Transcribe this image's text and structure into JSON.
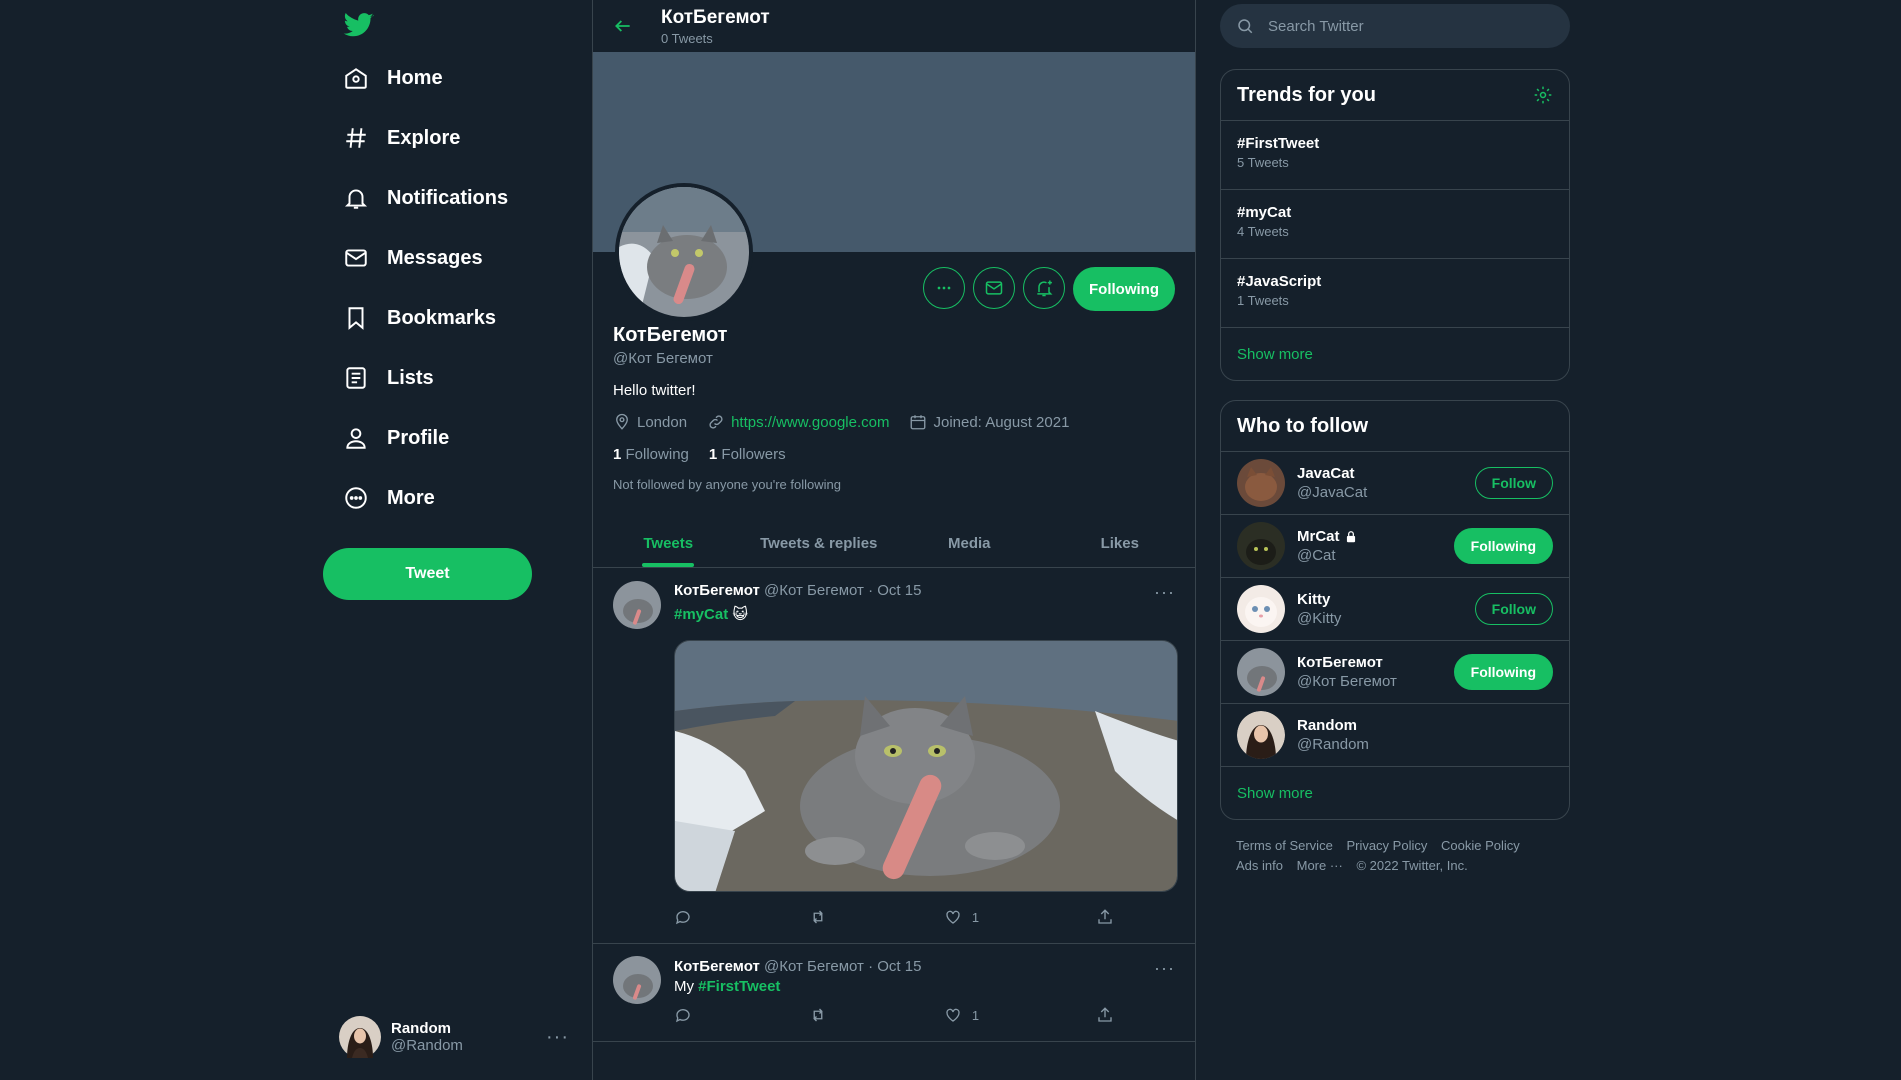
{
  "colors": {
    "background": "#15202b",
    "accent": "#17bf63",
    "border": "#38444d",
    "muted": "#8899a6",
    "banner": "#45596b"
  },
  "nav": {
    "logo_icon": "twitter-bird-icon",
    "items": [
      {
        "label": "Home",
        "icon": "home-icon"
      },
      {
        "label": "Explore",
        "icon": "hashtag-icon"
      },
      {
        "label": "Notifications",
        "icon": "bell-icon"
      },
      {
        "label": "Messages",
        "icon": "envelope-icon"
      },
      {
        "label": "Bookmarks",
        "icon": "bookmark-icon"
      },
      {
        "label": "Lists",
        "icon": "list-icon"
      },
      {
        "label": "Profile",
        "icon": "person-icon"
      },
      {
        "label": "More",
        "icon": "more-circle-icon"
      }
    ],
    "tweet_button": "Tweet",
    "account": {
      "name": "Random",
      "handle": "@Random"
    }
  },
  "profile": {
    "top_name": "КотБегемот",
    "tweet_count": "0 Tweets",
    "name": "КотБегемот",
    "handle": "@Кот Бегемот",
    "bio": "Hello twitter!",
    "location": "London",
    "website": "https://www.google.com",
    "joined": "Joined: August 2021",
    "following_count": "1",
    "following_label": "Following",
    "followers_count": "1",
    "followers_label": "Followers",
    "note": "Not followed by anyone you're following",
    "follow_button": "Following"
  },
  "tabs": [
    "Tweets",
    "Tweets & replies",
    "Media",
    "Likes"
  ],
  "tweets": [
    {
      "name": "КотБегемот",
      "handle": "@Кот Бегемот",
      "date": "Oct 15",
      "text_prefix": "",
      "hashtag": "#myCat",
      "emoji": "😺",
      "likes": "1"
    },
    {
      "name": "КотБегемот",
      "handle": "@Кот Бегемот",
      "date": "Oct 15",
      "text_prefix": "My ",
      "hashtag": "#FirstTweet",
      "emoji": "",
      "likes": "1"
    }
  ],
  "search": {
    "placeholder": "Search Twitter"
  },
  "trends": {
    "title": "Trends for you",
    "items": [
      {
        "tag": "#FirstTweet",
        "count": "5 Tweets"
      },
      {
        "tag": "#myCat",
        "count": "4 Tweets"
      },
      {
        "tag": "#JavaScript",
        "count": "1 Tweets"
      }
    ],
    "show_more": "Show more"
  },
  "who_to_follow": {
    "title": "Who to follow",
    "items": [
      {
        "name": "JavaCat",
        "handle": "@JavaCat",
        "button": "Follow",
        "locked": false
      },
      {
        "name": "MrCat",
        "handle": "@Cat",
        "button": "Following",
        "locked": true
      },
      {
        "name": "Kitty",
        "handle": "@Kitty",
        "button": "Follow",
        "locked": false
      },
      {
        "name": "КотБегемот",
        "handle": "@Кот Бегемот",
        "button": "Following",
        "locked": false
      },
      {
        "name": "Random",
        "handle": "@Random",
        "button": "",
        "locked": false
      }
    ],
    "show_more": "Show more"
  },
  "footer": {
    "links": [
      "Terms of Service",
      "Privacy Policy",
      "Cookie Policy",
      "Ads info",
      "More ···"
    ],
    "copyright": "© 2022 Twitter, Inc."
  }
}
